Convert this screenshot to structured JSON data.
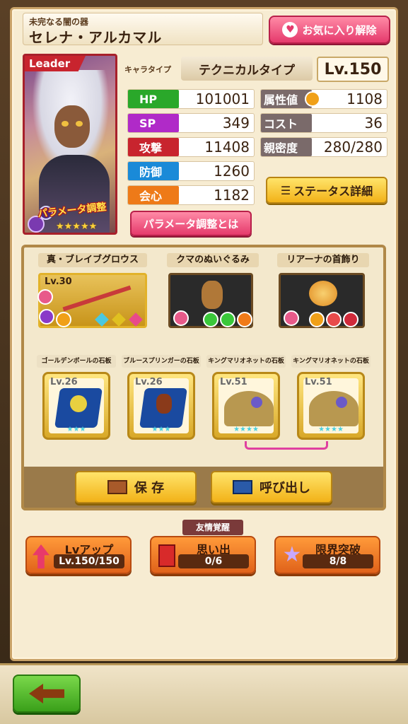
{
  "header": {
    "subtitle": "未完なる闇の器",
    "name": "セレナ・アルカマル",
    "fav_button": "お気に入り解除"
  },
  "portrait": {
    "leader_tag": "Leader",
    "param_label": "パラメータ調整",
    "stars": "★★★★★"
  },
  "profile": {
    "type_label": "キャラタイプ",
    "type_value": "テクニカルタイプ",
    "level": "Lv.150"
  },
  "stats_left": [
    {
      "label": "HP",
      "value": "101001",
      "color": "#2aa82a"
    },
    {
      "label": "SP",
      "value": "349",
      "color": "#b02ac8"
    },
    {
      "label": "攻撃",
      "value": "11408",
      "color": "#c8242e"
    },
    {
      "label": "防御",
      "value": "1260",
      "color": "#1a8ad8"
    },
    {
      "label": "会心",
      "value": "1182",
      "color": "#ee7a18"
    }
  ],
  "stats_right": [
    {
      "label": "属性値",
      "value": "1108",
      "color": "#7a6a6a"
    },
    {
      "label": "コスト",
      "value": "36",
      "color": "#7a6a6a"
    },
    {
      "label": "親密度",
      "value": "280/280",
      "color": "#7a6a6a"
    }
  ],
  "buttons": {
    "status_detail": "ステータス詳細",
    "param_about": "パラメータ調整とは",
    "save": "保 存",
    "load": "呼び出し"
  },
  "equipment": [
    {
      "title": "真・ブレイブグロウス",
      "level": "Lv.30"
    },
    {
      "title": "クマのぬいぐるみ"
    },
    {
      "title": "リアーナの首飾り"
    }
  ],
  "stones": [
    {
      "title": "ゴールデンボールの石板",
      "level": "Lv.26",
      "stars": "★★★"
    },
    {
      "title": "ブルースプリンガーの石板",
      "level": "Lv.26",
      "stars": "★★★"
    },
    {
      "title": "キングマリオネットの石板",
      "level": "Lv.51",
      "stars": "★★★★"
    },
    {
      "title": "キングマリオネットの石板",
      "level": "Lv.51",
      "stars": "★★★★"
    }
  ],
  "actions": {
    "friend_tag": "友情覚醒",
    "levelup": {
      "label": "Lvアップ",
      "value": "Lv.150/150"
    },
    "memory": {
      "label": "思い出",
      "value": "0/6"
    },
    "limit": {
      "label": "限界突破",
      "value": "8/8"
    }
  },
  "icons": {
    "heart": "♥",
    "back": "arrow-left-icon"
  }
}
